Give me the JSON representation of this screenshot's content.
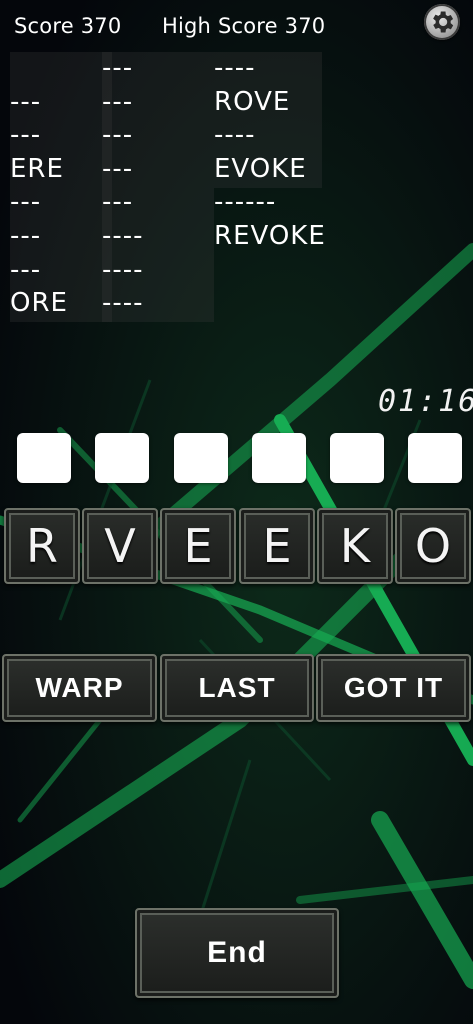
{
  "header": {
    "score_text": "Score 370",
    "high_score_text": "High Score 370",
    "settings_icon": "gear-icon"
  },
  "words": {
    "columns": [
      [
        "",
        "---",
        "---",
        "ERE",
        "---",
        "---",
        "---",
        "ORE"
      ],
      [
        "---",
        "---",
        "---",
        "---",
        "---",
        "----",
        "----",
        "----"
      ],
      [
        "----",
        "ROVE",
        "----",
        "EVOKE",
        "------",
        "REVOKE"
      ]
    ]
  },
  "timer": "01:16",
  "answer_slots": 6,
  "letters": [
    "R",
    "V",
    "E",
    "E",
    "K",
    "O"
  ],
  "buttons": {
    "warp": "WARP",
    "last": "LAST",
    "got_it": "GOT IT",
    "end": "End"
  },
  "colors": {
    "background": "#05070d",
    "accent_green": "#1fd86a",
    "tile_border": "#6d7268"
  }
}
